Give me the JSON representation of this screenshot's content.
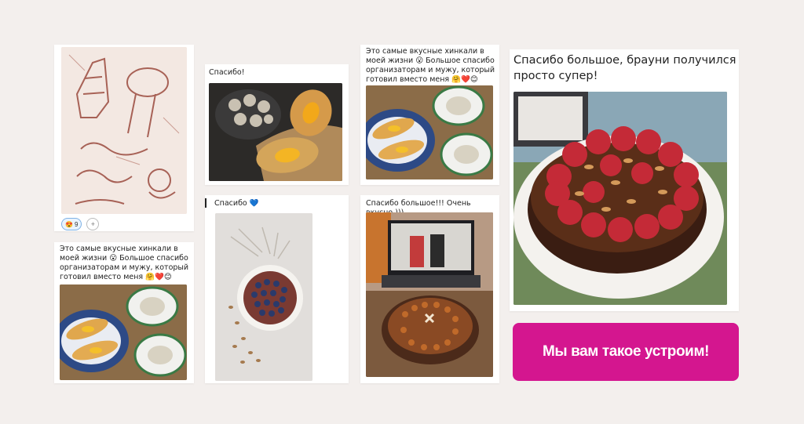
{
  "card1": {
    "reaction_emoji": "😍",
    "reaction_count": "9",
    "add_reaction": "+"
  },
  "card2": {
    "caption": "Спасибо!"
  },
  "card3": {
    "caption": "Спасибо 💙"
  },
  "card4": {
    "caption": "Это самые вкусные хинкали в\nмоей жизни 😮 Большое спасибо\nорганизаторам и мужу, который\nготовил вместо меня 🤗❤️😊"
  },
  "card5": {
    "caption": "Спасибо большое!!! Очень вкусно )))"
  },
  "card6": {
    "caption": "Это самые вкусные хинкали в\nмоей жизни 😮 Большое спасибо\nорганизаторам и мужу, который\nготовил вместо меня 🤗❤️😊"
  },
  "card7": {
    "caption": "Спасибо большое, брауни получился\nпросто супер!"
  },
  "cta": {
    "label": "Мы вам такое устроим!"
  },
  "colors": {
    "background": "#f3efed",
    "cta": "#d4168f"
  }
}
